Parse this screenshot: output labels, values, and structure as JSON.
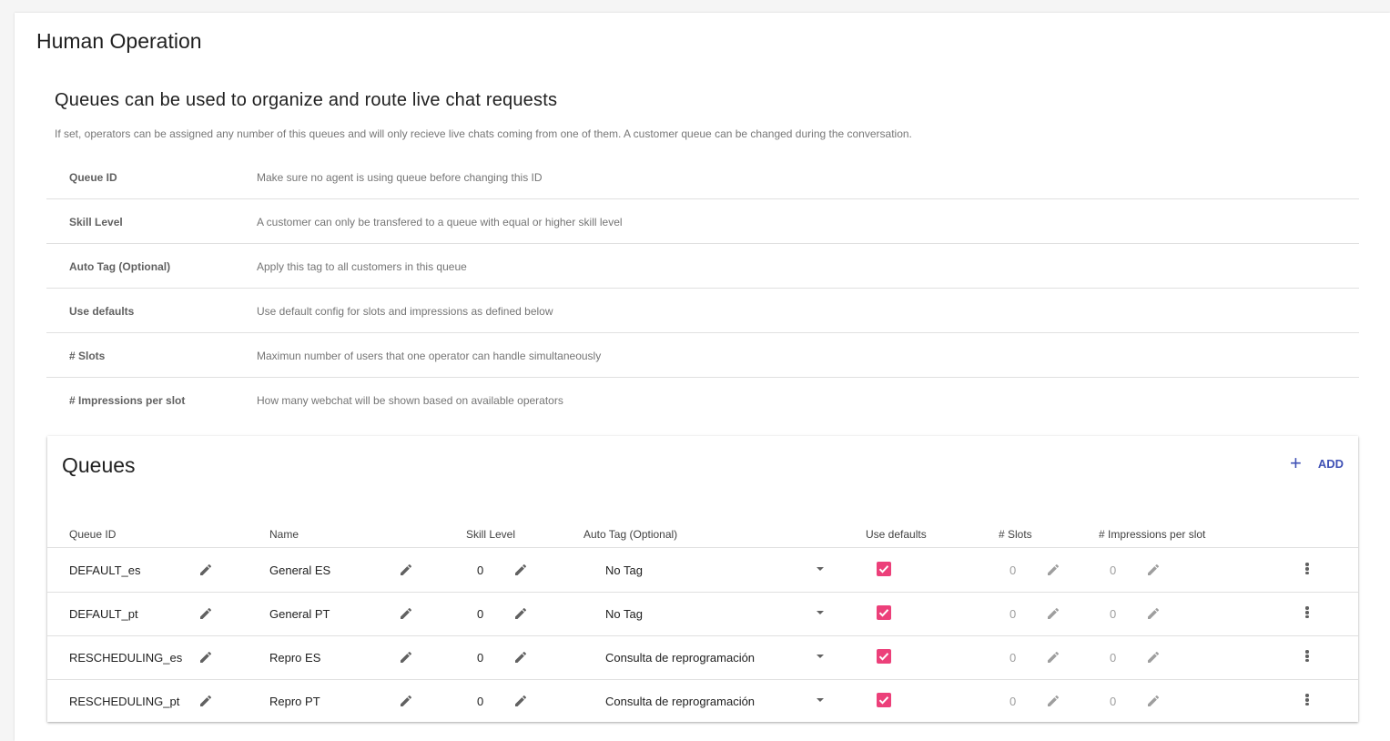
{
  "page": {
    "title": "Human Operation"
  },
  "intro": {
    "title": "Queues can be used to organize and route live chat requests",
    "description": "If set, operators can be assigned any number of this queues and will only recieve live chats coming from one of them. A customer queue can be changed during the conversation."
  },
  "definitions": [
    {
      "key": "Queue ID",
      "value": "Make sure no agent is using queue before changing this ID"
    },
    {
      "key": "Skill Level",
      "value": "A customer can only be transfered to a queue with equal or higher skill level"
    },
    {
      "key": "Auto Tag (Optional)",
      "value": "Apply this tag to all customers in this queue"
    },
    {
      "key": "Use defaults",
      "value": "Use default config for slots and impressions as defined below"
    },
    {
      "key": "# Slots",
      "value": "Maximun number of users that one operator can handle simultaneously"
    },
    {
      "key": "# Impressions per slot",
      "value": "How many webchat will be shown based on available operators"
    }
  ],
  "queues": {
    "title": "Queues",
    "add_label": "ADD",
    "columns": {
      "queue_id": "Queue ID",
      "name": "Name",
      "skill": "Skill Level",
      "autotag": "Auto Tag (Optional)",
      "defaults": "Use defaults",
      "slots": "# Slots",
      "impressions": "# Impressions per slot"
    },
    "rows": [
      {
        "queue_id": "DEFAULT_es",
        "name": "General ES",
        "skill": "0",
        "autotag": "No Tag",
        "use_defaults": true,
        "slots": "0",
        "impressions": "0"
      },
      {
        "queue_id": "DEFAULT_pt",
        "name": "General PT",
        "skill": "0",
        "autotag": "No Tag",
        "use_defaults": true,
        "slots": "0",
        "impressions": "0"
      },
      {
        "queue_id": "RESCHEDULING_es",
        "name": "Repro ES",
        "skill": "0",
        "autotag": "Consulta de reprogramación",
        "use_defaults": true,
        "slots": "0",
        "impressions": "0"
      },
      {
        "queue_id": "RESCHEDULING_pt",
        "name": "Repro PT",
        "skill": "0",
        "autotag": "Consulta de reprogramación",
        "use_defaults": true,
        "slots": "0",
        "impressions": "0"
      }
    ]
  },
  "colors": {
    "accent": "#3f51b5",
    "checkbox": "#ec407a"
  }
}
